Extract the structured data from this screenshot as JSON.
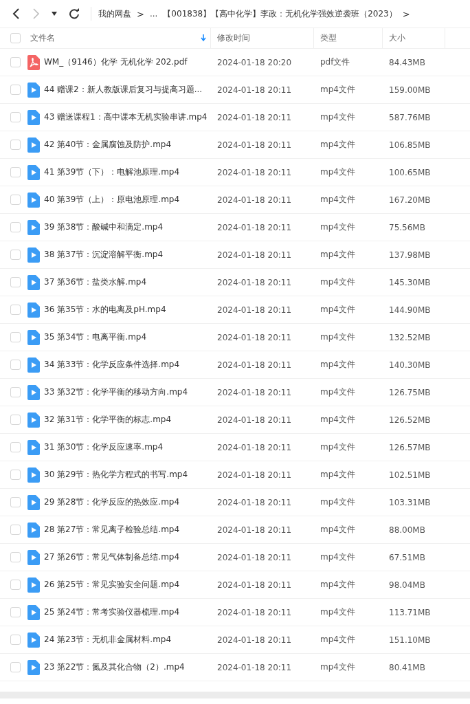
{
  "nav": {
    "breadcrumb": [
      "我的网盘",
      ">",
      "...",
      "【001838】【高中化学】李政：无机化学强效逆袭班（2023）",
      ">"
    ]
  },
  "table": {
    "all_checked": false,
    "columns": [
      {
        "label": "文件名",
        "sorted": true
      },
      {
        "label": "修改时间",
        "sorted": false
      },
      {
        "label": "类型",
        "sorted": false
      },
      {
        "label": "大小",
        "sorted": false
      }
    ],
    "rows": [
      {
        "kind": "pdf",
        "name": "WM_（9146）化学 无机化学 202.pdf",
        "time": "2024-01-18 20:20",
        "type": "pdf文件",
        "size": "84.43MB",
        "checked": false
      },
      {
        "kind": "video",
        "name": "44 赠课2：新人教版课后复习与提高习题...",
        "time": "2024-01-18 20:11",
        "type": "mp4文件",
        "size": "159.00MB",
        "checked": false
      },
      {
        "kind": "video",
        "name": "43 赠送课程1：高中课本无机实验串讲.mp4",
        "time": "2024-01-18 20:11",
        "type": "mp4文件",
        "size": "587.76MB",
        "checked": false
      },
      {
        "kind": "video",
        "name": "42 第40节：金属腐蚀及防护.mp4",
        "time": "2024-01-18 20:11",
        "type": "mp4文件",
        "size": "106.85MB",
        "checked": false
      },
      {
        "kind": "video",
        "name": "41 第39节（下）：电解池原理.mp4",
        "time": "2024-01-18 20:11",
        "type": "mp4文件",
        "size": "100.65MB",
        "checked": false
      },
      {
        "kind": "video",
        "name": "40 第39节（上）：原电池原理.mp4",
        "time": "2024-01-18 20:11",
        "type": "mp4文件",
        "size": "167.20MB",
        "checked": false
      },
      {
        "kind": "video",
        "name": "39 第38节：酸碱中和滴定.mp4",
        "time": "2024-01-18 20:11",
        "type": "mp4文件",
        "size": "75.56MB",
        "checked": false
      },
      {
        "kind": "video",
        "name": "38 第37节：沉淀溶解平衡.mp4",
        "time": "2024-01-18 20:11",
        "type": "mp4文件",
        "size": "137.98MB",
        "checked": false
      },
      {
        "kind": "video",
        "name": "37 第36节：盐类水解.mp4",
        "time": "2024-01-18 20:11",
        "type": "mp4文件",
        "size": "145.30MB",
        "checked": false
      },
      {
        "kind": "video",
        "name": "36 第35节：水的电离及pH.mp4",
        "time": "2024-01-18 20:11",
        "type": "mp4文件",
        "size": "144.90MB",
        "checked": false
      },
      {
        "kind": "video",
        "name": "35 第34节：电离平衡.mp4",
        "time": "2024-01-18 20:11",
        "type": "mp4文件",
        "size": "132.52MB",
        "checked": false
      },
      {
        "kind": "video",
        "name": "34 第33节：化学反应条件选择.mp4",
        "time": "2024-01-18 20:11",
        "type": "mp4文件",
        "size": "140.30MB",
        "checked": false
      },
      {
        "kind": "video",
        "name": "33 第32节：化学平衡的移动方向.mp4",
        "time": "2024-01-18 20:11",
        "type": "mp4文件",
        "size": "126.75MB",
        "checked": false
      },
      {
        "kind": "video",
        "name": "32 第31节：化学平衡的标志.mp4",
        "time": "2024-01-18 20:11",
        "type": "mp4文件",
        "size": "126.52MB",
        "checked": false
      },
      {
        "kind": "video",
        "name": "31 第30节：化学反应速率.mp4",
        "time": "2024-01-18 20:11",
        "type": "mp4文件",
        "size": "126.57MB",
        "checked": false
      },
      {
        "kind": "video",
        "name": "30 第29节：热化学方程式的书写.mp4",
        "time": "2024-01-18 20:11",
        "type": "mp4文件",
        "size": "102.51MB",
        "checked": false
      },
      {
        "kind": "video",
        "name": "29 第28节：化学反应的热效应.mp4",
        "time": "2024-01-18 20:11",
        "type": "mp4文件",
        "size": "103.31MB",
        "checked": false
      },
      {
        "kind": "video",
        "name": "28 第27节：常见离子检验总结.mp4",
        "time": "2024-01-18 20:11",
        "type": "mp4文件",
        "size": "88.00MB",
        "checked": false
      },
      {
        "kind": "video",
        "name": "27 第26节：常见气体制备总结.mp4",
        "time": "2024-01-18 20:11",
        "type": "mp4文件",
        "size": "67.51MB",
        "checked": false
      },
      {
        "kind": "video",
        "name": "26 第25节：常见实验安全问题.mp4",
        "time": "2024-01-18 20:11",
        "type": "mp4文件",
        "size": "98.04MB",
        "checked": false
      },
      {
        "kind": "video",
        "name": "25 第24节：常考实验仪器梳理.mp4",
        "time": "2024-01-18 20:11",
        "type": "mp4文件",
        "size": "113.71MB",
        "checked": false
      },
      {
        "kind": "video",
        "name": "24 第23节：无机非金属材料.mp4",
        "time": "2024-01-18 20:11",
        "type": "mp4文件",
        "size": "151.10MB",
        "checked": false
      },
      {
        "kind": "video",
        "name": "23 第22节：氮及其化合物（2）.mp4",
        "time": "2024-01-18 20:11",
        "type": "mp4文件",
        "size": "80.41MB",
        "checked": false
      }
    ]
  }
}
